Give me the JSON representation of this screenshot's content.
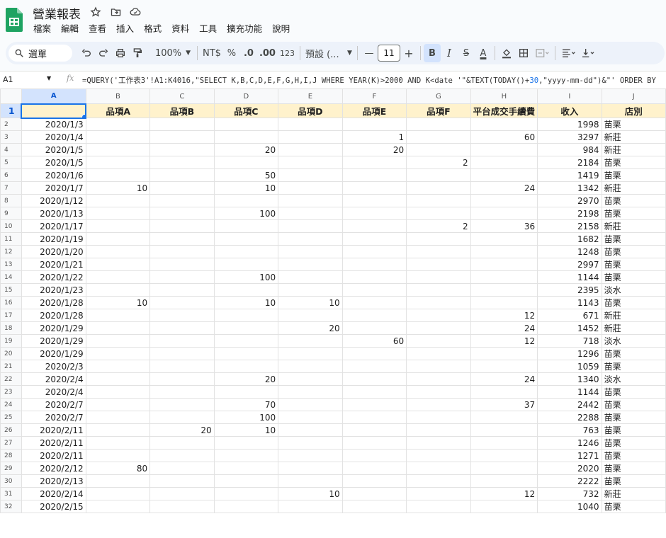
{
  "app": {
    "doc_title": "營業報表",
    "menu": [
      "檔案",
      "編輯",
      "查看",
      "插入",
      "格式",
      "資料",
      "工具",
      "擴充功能",
      "說明"
    ]
  },
  "toolbar": {
    "search_label": "選單",
    "zoom": "100%",
    "currency": "NT$",
    "percent": "%",
    "dec_decrease": ".0",
    "dec_increase": ".00",
    "num_format": "123",
    "font_name": "預設 (...",
    "font_size": "11",
    "minus": "—",
    "plus": "+",
    "bold": "B",
    "italic": "I",
    "strike": "S",
    "text_color": "A"
  },
  "formula_bar": {
    "cell_ref": "A1",
    "fx": "fx",
    "formula_pre": "=QUERY('工作表3'!A1:K4016,\"SELECT K,B,C,D,E,F,G,H,I,J WHERE YEAR(K)>2000 AND K<date '\"&TEXT(TODAY()+",
    "formula_num": "30",
    "formula_post": ",\"yyyy-mm-dd\")&\"' ORDER BY"
  },
  "columns": [
    "A",
    "B",
    "C",
    "D",
    "E",
    "F",
    "G",
    "H",
    "I",
    "J"
  ],
  "header_row": [
    "",
    "品項A",
    "品項B",
    "品項C",
    "品項D",
    "品項E",
    "品項F",
    "平台成交手續費",
    "收入",
    "店別"
  ],
  "rows": [
    [
      "2020/1/3",
      "",
      "",
      "",
      "",
      "",
      "",
      "",
      "1998",
      "苗栗"
    ],
    [
      "2020/1/4",
      "",
      "",
      "",
      "",
      "1",
      "",
      "60",
      "3297",
      "新莊"
    ],
    [
      "2020/1/5",
      "",
      "",
      "20",
      "",
      "20",
      "",
      "",
      "984",
      "新莊"
    ],
    [
      "2020/1/5",
      "",
      "",
      "",
      "",
      "",
      "2",
      "",
      "2184",
      "苗栗"
    ],
    [
      "2020/1/6",
      "",
      "",
      "50",
      "",
      "",
      "",
      "",
      "1419",
      "苗栗"
    ],
    [
      "2020/1/7",
      "10",
      "",
      "10",
      "",
      "",
      "",
      "24",
      "1342",
      "新莊"
    ],
    [
      "2020/1/12",
      "",
      "",
      "",
      "",
      "",
      "",
      "",
      "2970",
      "苗栗"
    ],
    [
      "2020/1/13",
      "",
      "",
      "100",
      "",
      "",
      "",
      "",
      "2198",
      "苗栗"
    ],
    [
      "2020/1/17",
      "",
      "",
      "",
      "",
      "",
      "2",
      "36",
      "2158",
      "新莊"
    ],
    [
      "2020/1/19",
      "",
      "",
      "",
      "",
      "",
      "",
      "",
      "1682",
      "苗栗"
    ],
    [
      "2020/1/20",
      "",
      "",
      "",
      "",
      "",
      "",
      "",
      "1248",
      "苗栗"
    ],
    [
      "2020/1/21",
      "",
      "",
      "",
      "",
      "",
      "",
      "",
      "2997",
      "苗栗"
    ],
    [
      "2020/1/22",
      "",
      "",
      "100",
      "",
      "",
      "",
      "",
      "1144",
      "苗栗"
    ],
    [
      "2020/1/23",
      "",
      "",
      "",
      "",
      "",
      "",
      "",
      "2395",
      "淡水"
    ],
    [
      "2020/1/28",
      "10",
      "",
      "10",
      "10",
      "",
      "",
      "",
      "1143",
      "苗栗"
    ],
    [
      "2020/1/28",
      "",
      "",
      "",
      "",
      "",
      "",
      "12",
      "671",
      "新莊"
    ],
    [
      "2020/1/29",
      "",
      "",
      "",
      "20",
      "",
      "",
      "24",
      "1452",
      "新莊"
    ],
    [
      "2020/1/29",
      "",
      "",
      "",
      "",
      "60",
      "",
      "12",
      "718",
      "淡水"
    ],
    [
      "2020/1/29",
      "",
      "",
      "",
      "",
      "",
      "",
      "",
      "1296",
      "苗栗"
    ],
    [
      "2020/2/3",
      "",
      "",
      "",
      "",
      "",
      "",
      "",
      "1059",
      "苗栗"
    ],
    [
      "2020/2/4",
      "",
      "",
      "20",
      "",
      "",
      "",
      "24",
      "1340",
      "淡水"
    ],
    [
      "2020/2/4",
      "",
      "",
      "",
      "",
      "",
      "",
      "",
      "1144",
      "苗栗"
    ],
    [
      "2020/2/7",
      "",
      "",
      "70",
      "",
      "",
      "",
      "37",
      "2442",
      "苗栗"
    ],
    [
      "2020/2/7",
      "",
      "",
      "100",
      "",
      "",
      "",
      "",
      "2288",
      "苗栗"
    ],
    [
      "2020/2/11",
      "",
      "20",
      "10",
      "",
      "",
      "",
      "",
      "763",
      "苗栗"
    ],
    [
      "2020/2/11",
      "",
      "",
      "",
      "",
      "",
      "",
      "",
      "1246",
      "苗栗"
    ],
    [
      "2020/2/11",
      "",
      "",
      "",
      "",
      "",
      "",
      "",
      "1271",
      "苗栗"
    ],
    [
      "2020/2/12",
      "80",
      "",
      "",
      "",
      "",
      "",
      "",
      "2020",
      "苗栗"
    ],
    [
      "2020/2/13",
      "",
      "",
      "",
      "",
      "",
      "",
      "",
      "2222",
      "苗栗"
    ],
    [
      "2020/2/14",
      "",
      "",
      "",
      "10",
      "",
      "",
      "12",
      "732",
      "新莊"
    ],
    [
      "2020/2/15",
      "",
      "",
      "",
      "",
      "",
      "",
      "",
      "1040",
      "苗栗"
    ]
  ]
}
